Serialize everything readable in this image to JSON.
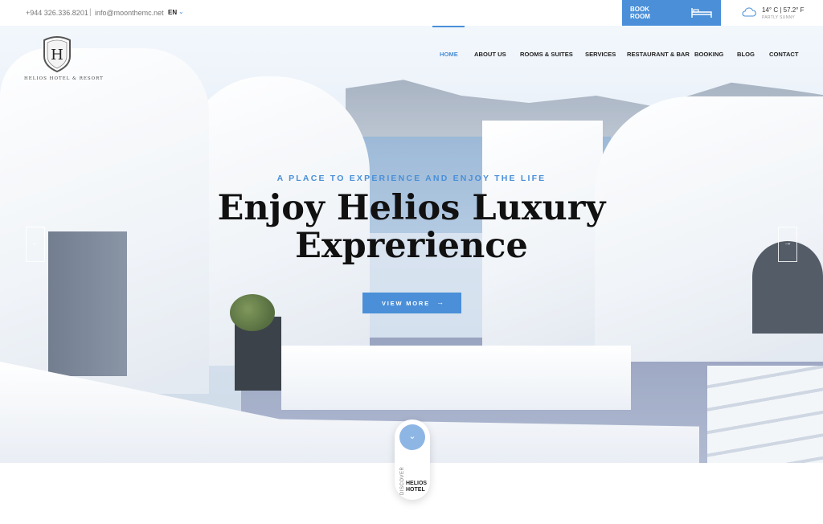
{
  "topbar": {
    "phone": "+944 326.336.8201",
    "separator": "|",
    "email": "info@moonthemc.net",
    "language": "EN",
    "book_room_label": "BOOK ROOM",
    "weather": {
      "temperature": "14° C | 57.2° F",
      "condition": "PARTLY SUNNY"
    }
  },
  "logo": {
    "letter": "H",
    "text": "HELIOS HOTEL & RESORT"
  },
  "nav": {
    "items": [
      {
        "label": "HOME",
        "active": true
      },
      {
        "label": "ABOUT US",
        "active": false
      },
      {
        "label": "ROOMS & SUITES",
        "active": false
      },
      {
        "label": "SERVICES",
        "active": false
      },
      {
        "label": "RESTAURANT & BAR",
        "active": false
      },
      {
        "label": "BOOKING",
        "active": false
      },
      {
        "label": "BLOG",
        "active": false
      },
      {
        "label": "CONTACT",
        "active": false
      }
    ]
  },
  "hero": {
    "tagline": "A PLACE TO EXPERIENCE AND ENJOY THE LIFE",
    "headline": "Enjoy Helios Luxury Exprerience",
    "cta_label": "VIEW MORE",
    "cta_arrow": "→",
    "prev_arrow": "←",
    "next_arrow": "→"
  },
  "discover": {
    "small": "DISCOVER",
    "big": "HELIOS HOTEL",
    "chevron": "⌄"
  },
  "colors": {
    "accent": "#4a8fd8",
    "text": "#111111"
  }
}
